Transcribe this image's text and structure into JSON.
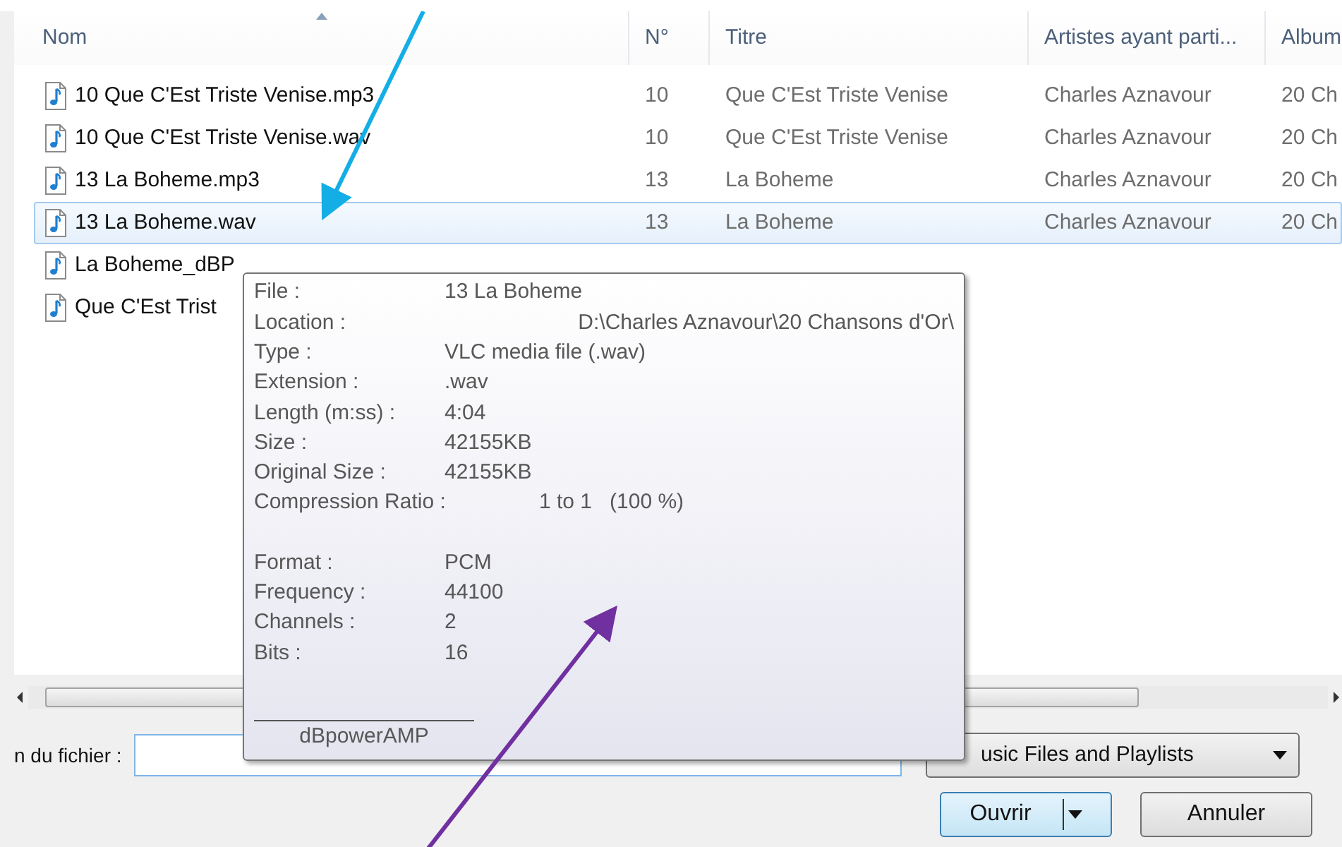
{
  "file_list": {
    "columns": [
      {
        "label": "Nom",
        "sorted": true
      },
      {
        "label": "N°",
        "sorted": false
      },
      {
        "label": "Titre",
        "sorted": false
      },
      {
        "label": "Artistes ayant parti...",
        "sorted": false
      },
      {
        "label": "Album",
        "sorted": false
      }
    ],
    "rows": [
      {
        "cells": [
          "10 Que C'Est Triste Venise.mp3",
          "10",
          "Que C'Est Triste Venise",
          "Charles Aznavour",
          "20 Ch"
        ],
        "selected": false
      },
      {
        "cells": [
          "10 Que C'Est Triste Venise.wav",
          "10",
          "Que C'Est Triste Venise",
          "Charles Aznavour",
          "20 Ch"
        ],
        "selected": false
      },
      {
        "cells": [
          "13 La Boheme.mp3",
          "13",
          "La Boheme",
          "Charles Aznavour",
          "20 Ch"
        ],
        "selected": false
      },
      {
        "cells": [
          "13 La Boheme.wav",
          "13",
          "La Boheme",
          "Charles Aznavour",
          "20 Ch"
        ],
        "selected": true
      },
      {
        "cells": [
          "La Boheme_dBP"
        ],
        "selected": false
      },
      {
        "cells": [
          "Que C'Est Trist"
        ],
        "selected": false
      }
    ]
  },
  "tooltip": {
    "sections": [
      [
        {
          "label": "File :",
          "value": "13 La Boheme",
          "kind": "plain"
        },
        {
          "label": "Location :",
          "value": "D:\\Charles Aznavour\\20 Chansons d'Or\\",
          "kind": "right"
        },
        {
          "label": "Type :",
          "value": "VLC media file (.wav)",
          "kind": "plain"
        },
        {
          "label": "Extension :",
          "value": ".wav",
          "kind": "plain"
        },
        {
          "label": "Length (m:ss) :",
          "value": "4:04",
          "kind": "plain"
        },
        {
          "label": "Size :",
          "value": "42155KB",
          "kind": "plain"
        },
        {
          "label": "Original Size :",
          "value": "42155KB",
          "kind": "plain"
        },
        {
          "label": "Compression Ratio :",
          "value": "1 to 1   (100 %)",
          "kind": "spaced"
        }
      ],
      [
        {
          "label": "Format :",
          "value": "PCM",
          "kind": "plain"
        },
        {
          "label": "Frequency :",
          "value": "44100",
          "kind": "plain"
        },
        {
          "label": "Channels :",
          "value": "2",
          "kind": "plain"
        },
        {
          "label": "Bits :",
          "value": "16",
          "kind": "plain"
        }
      ]
    ],
    "footer": "dBpowerAMP"
  },
  "file_name": {
    "label": "n du fichier :"
  },
  "file_type": {
    "value": "usic Files and Playlists"
  },
  "buttons": [
    {
      "label": "Ouvrir",
      "kind": "split"
    },
    {
      "label": "Annuler",
      "kind": "plain"
    }
  ]
}
